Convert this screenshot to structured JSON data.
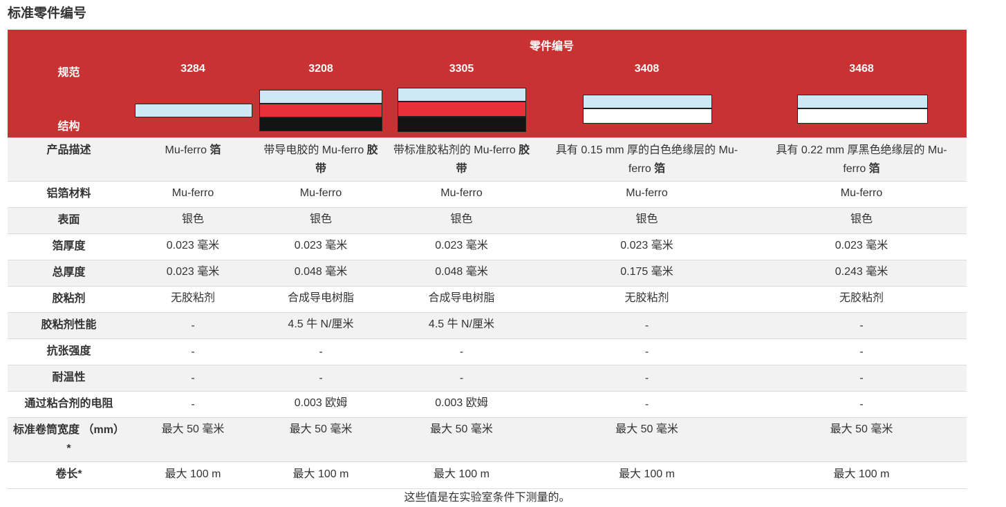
{
  "page_title": "标准零件编号",
  "header": {
    "group_label": "零件编号",
    "spec_label": "规范",
    "structure_label": "结构",
    "parts": [
      "3284",
      "3208",
      "3305",
      "3408",
      "3468"
    ]
  },
  "colors": {
    "header_bg": "#c83232",
    "layer_blue": "#cde9f5",
    "layer_red": "#e8303a",
    "layer_black": "#141414",
    "layer_white": "#ffffff"
  },
  "rows": [
    {
      "label": "产品描述",
      "values": [
        {
          "text": "Mu-ferro ",
          "bold": "箔"
        },
        {
          "text": "带导电胶的 Mu-ferro ",
          "bold": "胶带"
        },
        {
          "text": "带标准胶粘剂的 Mu-ferro ",
          "bold": "胶带"
        },
        {
          "text": "具有 0.15 mm 厚的白色绝缘层的 Mu-ferro ",
          "bold": "箔"
        },
        {
          "text": "具有 0.22 mm 厚黑色绝缘层的 Mu-ferro ",
          "bold": "箔"
        }
      ]
    },
    {
      "label": "铝箔材料",
      "values": [
        "Mu-ferro",
        "Mu-ferro",
        "Mu-ferro",
        "Mu-ferro",
        "Mu-ferro"
      ]
    },
    {
      "label": "表面",
      "values": [
        "银色",
        "银色",
        "银色",
        "银色",
        "银色"
      ]
    },
    {
      "label": "箔厚度",
      "values": [
        "0.023 毫米",
        "0.023 毫米",
        "0.023 毫米",
        "0.023 毫米",
        "0.023 毫米"
      ]
    },
    {
      "label": "总厚度",
      "values": [
        "0.023 毫米",
        "0.048 毫米",
        "0.048 毫米",
        "0.175 毫米",
        "0.243 毫米"
      ]
    },
    {
      "label": "胶粘剂",
      "values": [
        "无胶粘剂",
        "合成导电树脂",
        "合成导电树脂",
        "无胶粘剂",
        "无胶粘剂"
      ]
    },
    {
      "label": "胶粘剂性能",
      "values": [
        "-",
        "4.5 牛 N/厘米",
        "4.5 牛 N/厘米",
        "-",
        "-"
      ]
    },
    {
      "label": "抗张强度",
      "values": [
        "-",
        "-",
        "-",
        "-",
        "-"
      ]
    },
    {
      "label": "耐温性",
      "values": [
        "-",
        "-",
        "-",
        "-",
        "-"
      ]
    },
    {
      "label": "通过粘合剂的电阻",
      "values": [
        "-",
        "0.003 欧姆",
        "0.003 欧姆",
        "-",
        "-"
      ]
    },
    {
      "label": "标准卷筒宽度 （mm）*",
      "values": [
        "最大 50 毫米",
        "最大 50 毫米",
        "最大 50 毫米",
        "最大 50 毫米",
        "最大 50 毫米"
      ]
    },
    {
      "label": "卷长*",
      "values": [
        "最大 100 m",
        "最大 100 m",
        "最大 100 m",
        "最大 100 m",
        "最大 100 m"
      ]
    }
  ],
  "footnote": "这些值是在实验室条件下测量的。"
}
